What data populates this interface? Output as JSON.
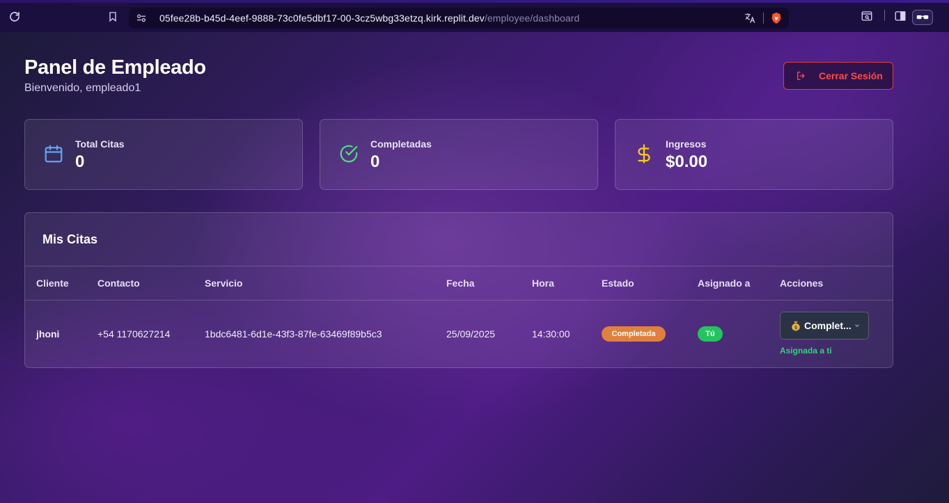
{
  "browser": {
    "url_host": "05fee28b-b45d-4eef-9888-73c0fe5dbf17-00-3cz5wbg33etzq.kirk.replit.dev",
    "url_path": "/employee/dashboard"
  },
  "header": {
    "title": "Panel de Empleado",
    "subtitle": "Bienvenido, empleado1",
    "logout_label": "Cerrar Sesión"
  },
  "stats": [
    {
      "label": "Total Citas",
      "value": "0",
      "icon": "calendar-icon",
      "color": "#60a5fa"
    },
    {
      "label": "Completadas",
      "value": "0",
      "icon": "check-circle-icon",
      "color": "#4ade80"
    },
    {
      "label": "Ingresos",
      "value": "$0.00",
      "icon": "dollar-icon",
      "color": "#facc15"
    }
  ],
  "appointments": {
    "title": "Mis Citas",
    "columns": [
      "Cliente",
      "Contacto",
      "Servicio",
      "Fecha",
      "Hora",
      "Estado",
      "Asignado a",
      "Acciones"
    ],
    "rows": [
      {
        "cliente": "jhoni",
        "contacto": "+54 1170627214",
        "servicio": "1bdc6481-6d1e-43f3-87fe-63469f89b5c3",
        "fecha": "25/09/2025",
        "hora": "14:30:00",
        "estado": "Completada",
        "asignado": "Tú",
        "accion": "Complet...",
        "nota": "Asignada a ti"
      }
    ]
  },
  "colors": {
    "accent_red": "#ff4a4a",
    "status_completed": "#e0803d",
    "assigned_green": "#22c55e"
  }
}
